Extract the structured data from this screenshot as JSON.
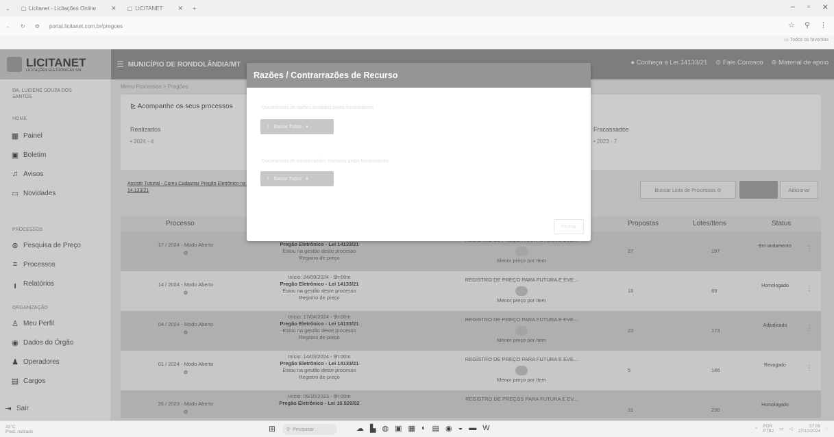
{
  "browser": {
    "tabs": [
      {
        "title": "Licitanet - Licitações Online"
      },
      {
        "title": "LICITANET"
      }
    ],
    "url": "portal.licitanet.com.br/pregoes",
    "bookmarks_label": "Todos os favoritos"
  },
  "header": {
    "logo": "LICITANET",
    "logo_sub": "LICITAÇÕES ELETRÔNICAS S/A",
    "municipality": "MUNICÍPIO DE RONDOLÂNDIA/MT",
    "links": [
      "Conheça a Lei 14133/21",
      "Fale Conosco",
      "Material de apoio"
    ]
  },
  "sidebar": {
    "user": "DA, LUCIENE SOUZA DOS SANTOS",
    "section_home": "HOME",
    "home_items": [
      {
        "label": "Painel",
        "icon": "grid-icon"
      },
      {
        "label": "Boletim",
        "icon": "newspaper-icon"
      },
      {
        "label": "Avisos",
        "icon": "bell-icon"
      },
      {
        "label": "Novidades",
        "icon": "chat-icon"
      }
    ],
    "section_processos": "PROCESSOS",
    "proc_items": [
      {
        "label": "Pesquisa de Preço",
        "icon": "search-icon"
      },
      {
        "label": "Processos",
        "icon": "list-icon"
      },
      {
        "label": "Relatórios",
        "icon": "bar-chart-icon"
      }
    ],
    "section_org": "ORGANIZAÇÃO",
    "org_items": [
      {
        "label": "Meu Perfil",
        "icon": "user-icon"
      },
      {
        "label": "Dados do Órgão",
        "icon": "info-icon"
      },
      {
        "label": "Operadores",
        "icon": "users-icon"
      },
      {
        "label": "Cargos",
        "icon": "badge-icon"
      }
    ],
    "logout": "Sair"
  },
  "main": {
    "breadcrumb": "Menu Processos > Pregões",
    "card_title": "Acompanhe os seus processos",
    "stats": [
      {
        "label": "Realizados",
        "value": "• 2024 - 4"
      },
      {
        "label": "Fracassados",
        "value": "• 2023 - 7"
      }
    ],
    "tutorial_link": "Assistir Tutorial - Como Cadastrar Pregão Eletrônico na Lei 14.133/21",
    "search_button": "Buscar Lista de Processos",
    "add_button": "Adicionar",
    "columns": [
      "Processo",
      "Propostas",
      "Lotes/Itens",
      "Status"
    ],
    "rows": [
      {
        "processo": "17 / 2024 - Modo Aberto",
        "inicio": "",
        "modalidade": "Pregão Eletrônico - Lei 14133/21",
        "nota": "Estou na gestão deste processo",
        "tipo": "Registro de preço",
        "descricao": "REGISTRO DE PREÇO PARA FUTURA E EVE...",
        "criterio": "Menor preço por Item",
        "propostas": "27",
        "lotes": "197",
        "status": "Em andamento"
      },
      {
        "processo": "14 / 2024 - Modo Aberto",
        "inicio": "Início: 24/09/2024 - 9h:00m",
        "modalidade": "Pregão Eletrônico - Lei 14133/21",
        "nota": "Estou na gestão deste processo",
        "tipo": "Registro de preço",
        "descricao": "REGISTRO DE PREÇO PARA FUTURA E EVE...",
        "criterio": "Menor preço por Item",
        "propostas": "15",
        "lotes": "69",
        "status": "Homologado"
      },
      {
        "processo": "04 / 2024 - Modo Aberto",
        "inicio": "Início: 17/04/2024 - 9h:00m",
        "modalidade": "Pregão Eletrônico - Lei 14133/21",
        "nota": "Estou na gestão deste processo",
        "tipo": "Registro de preço",
        "descricao": "REGISTRO DE PREÇO PARA FUTURA E EVE...",
        "criterio": "Menor preço por Item",
        "propostas": "23",
        "lotes": "173",
        "status": "Adjudicado"
      },
      {
        "processo": "01 / 2024 - Modo Aberto",
        "inicio": "Início: 14/03/2024 - 9h:00m",
        "modalidade": "Pregão Eletrônico - Lei 14133/21",
        "nota": "Estou na gestão deste processo",
        "tipo": "Registro de preço",
        "descricao": "REGISTRO DE PREÇO PARA FUTURA E EVE...",
        "criterio": "Menor preço por Item",
        "propostas": "5",
        "lotes": "146",
        "status": "Revogado"
      },
      {
        "processo": "26 / 2023 - Modo Aberto",
        "inicio": "Início: 09/10/2023 - 9h:00m",
        "modalidade": "Pregão Eletrônico - Lei 10.520/02",
        "nota": "",
        "tipo": "",
        "descricao": "REGISTRO DE PREÇOS PARA FUTURA E EV...",
        "criterio": "",
        "propostas": "31",
        "lotes": "230",
        "status": "Homologado"
      }
    ]
  },
  "modal": {
    "title": "Razões / Contrarrazões de Recurso",
    "note1": "Documentos de razões enviados pelos fornecedores",
    "button1": "Baixar Todos",
    "note2": "Documentos de contrarrazões enviados pelos fornecedores",
    "button2": "Baixar Todos",
    "close": "Fechar"
  },
  "taskbar": {
    "weather": "25°C",
    "weather_sub": "Pred. nublado",
    "search": "Pesquisar",
    "lang": "POR",
    "lang_sub": "PTB2",
    "time": "07:09",
    "date": "27/10/2024"
  }
}
